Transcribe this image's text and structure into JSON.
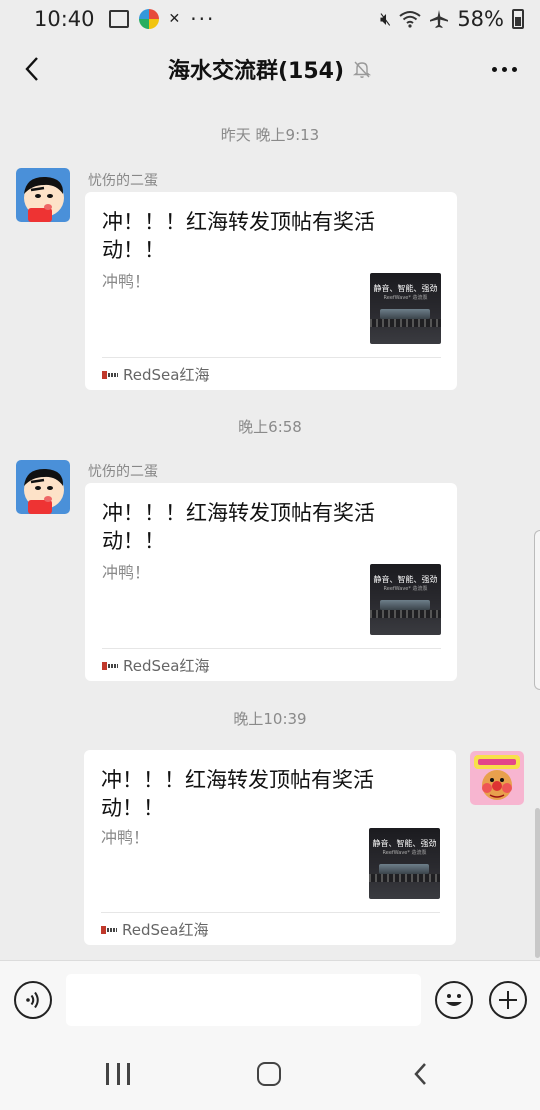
{
  "status_bar": {
    "time": "10:40",
    "battery": "58%",
    "more": "···"
  },
  "header": {
    "title": "海水交流群(154)"
  },
  "messages": [
    {
      "timestamp": "昨天 晚上9:13",
      "sender": "忧伤的二蛋",
      "title": "冲！！！红海转发顶帖有奖活动！！",
      "description": "冲鸭！",
      "thumb_text": "静音、智能、强劲",
      "thumb_sub": "ReefWave* 造流泵",
      "source": "RedSea红海"
    },
    {
      "timestamp": "晚上6:58",
      "sender": "忧伤的二蛋",
      "title": "冲！！！红海转发顶帖有奖活动！！",
      "description": "冲鸭！",
      "thumb_text": "静音、智能、强劲",
      "thumb_sub": "ReefWave* 造流泵",
      "source": "RedSea红海"
    },
    {
      "timestamp": "晚上10:39",
      "title": "冲！！！红海转发顶帖有奖活动！！",
      "description": "冲鸭！",
      "thumb_text": "静音、智能、强劲",
      "thumb_sub": "ReefWave* 造流泵",
      "source": "RedSea红海"
    }
  ],
  "colors": {
    "background": "#ededed",
    "card": "#ffffff",
    "muted_text": "#8a8a8a"
  }
}
